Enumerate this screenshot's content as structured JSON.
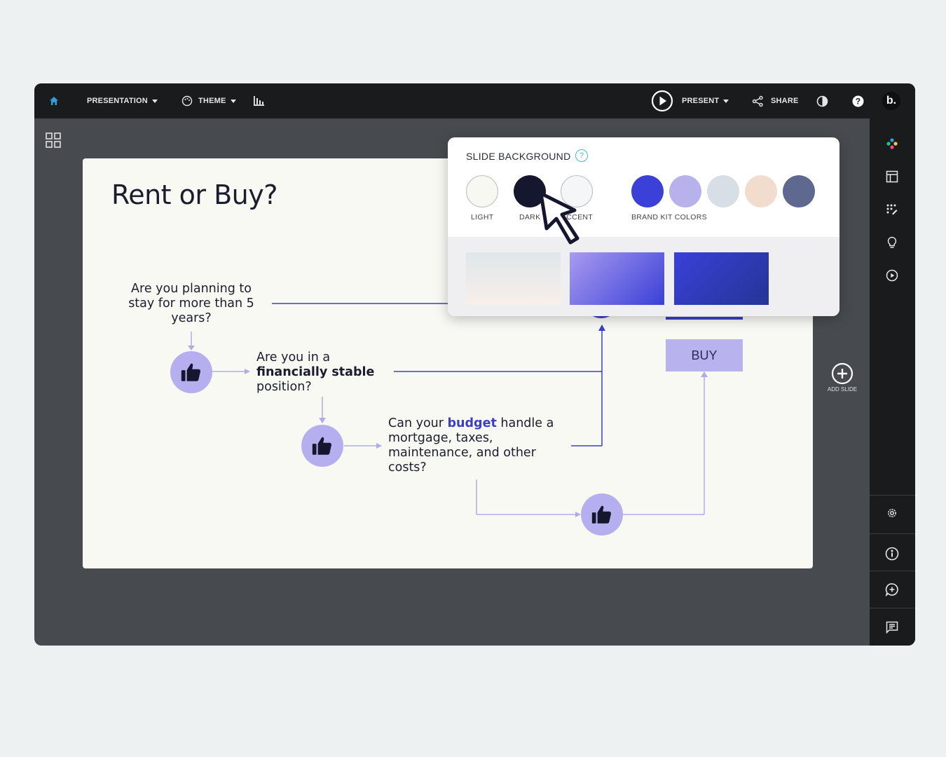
{
  "topbar": {
    "presentation_label": "PRESENTATION",
    "theme_label": "THEME",
    "present_label": "PRESENT",
    "share_label": "SHARE",
    "avatar_text": "b."
  },
  "slide": {
    "title": "Rent or Buy?",
    "q1": "Are you planning to stay for more than 5 years?",
    "q2_pre": "Are you in a",
    "q2_bold": "financially stable",
    "q2_post": "position?",
    "q3_pre": "Can your",
    "q3_accent": "budget",
    "q3_post": "handle a mortgage, taxes, maintenance, and other costs?",
    "buy_label": "BUY"
  },
  "add_slide_label": "ADD SLIDE",
  "popover": {
    "title": "SLIDE BACKGROUND",
    "help": "?",
    "labels": {
      "light": "LIGHT",
      "dark": "DARK",
      "accent": "ACCENT",
      "brand": "BRAND KIT COLORS"
    },
    "swatches": {
      "light": "#f8f8f3",
      "dark": "#15172e",
      "accent": "#f4f6f8",
      "brand": [
        "#3a40d8",
        "#b8b2ec",
        "#d8dee5",
        "#f2dccd",
        "#5f6990"
      ]
    },
    "gradients": [
      [
        "#dfe6ea",
        "#f8efea"
      ],
      [
        "#a99bf0",
        "#3a40d8"
      ],
      [
        "#3a40d8",
        "#243596"
      ]
    ]
  },
  "colors": {
    "accent": "#3b3fc6",
    "thumb_bg": "#b5aff0",
    "home_icon": "#2f9fd9"
  }
}
